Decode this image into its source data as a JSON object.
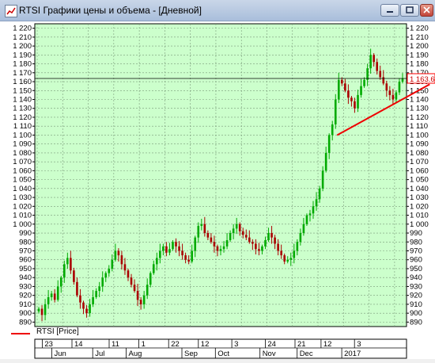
{
  "window": {
    "title": "RTSI Графики цены и объема - [Дневной]",
    "buttons": [
      "minimize",
      "maximize",
      "close"
    ]
  },
  "colors": {
    "plot_bg": "#ccffcc",
    "bull": "#00aa00",
    "bear": "#aa0000",
    "trendline": "#ee0000",
    "price_tag_bg": "#ffffff",
    "price_tag_border": "#ff0000"
  },
  "chart_data": {
    "type": "candlestick",
    "title": "",
    "ylim": [
      885,
      1225
    ],
    "yticks": [
      890,
      900,
      910,
      920,
      930,
      940,
      950,
      960,
      970,
      980,
      990,
      1000,
      1010,
      1020,
      1030,
      1040,
      1050,
      1060,
      1070,
      1080,
      1090,
      1100,
      1110,
      1120,
      1130,
      1140,
      1150,
      1160,
      1170,
      1180,
      1190,
      1200,
      1210,
      1220
    ],
    "ytick_labels": [
      "890",
      "900",
      "910",
      "920",
      "930",
      "940",
      "950",
      "960",
      "970",
      "980",
      "990",
      "1 000",
      "1 010",
      "1 020",
      "1 030",
      "1 040",
      "1 050",
      "1 060",
      "1 070",
      "1 080",
      "1 090",
      "1 100",
      "1 110",
      "1 120",
      "1 130",
      "1 140",
      "1 150",
      "1 160",
      "1 170",
      "1 180",
      "1 190",
      "1 200",
      "1 210",
      "1 220"
    ],
    "last_price_label": "1 163.6",
    "last_price": 1163.6,
    "grid": true,
    "series": [
      {
        "name": "RTSI [Price]"
      }
    ],
    "x_day_labels": [
      "23",
      "14",
      "11",
      "1",
      "22",
      "12",
      "3",
      "24",
      "21",
      "12",
      "3"
    ],
    "x_month_labels": [
      "Jun",
      "Jul",
      "Aug",
      "Sep",
      "Oct",
      "Nov",
      "Dec",
      "2017"
    ],
    "trendline": {
      "from_price": 1100,
      "to_price": 1157
    },
    "closes": [
      905,
      898,
      910,
      918,
      922,
      915,
      930,
      940,
      955,
      962,
      948,
      935,
      920,
      912,
      905,
      900,
      910,
      918,
      925,
      930,
      940,
      945,
      950,
      960,
      970,
      965,
      955,
      948,
      940,
      932,
      925,
      915,
      910,
      920,
      932,
      945,
      955,
      962,
      970,
      975,
      968,
      972,
      980,
      975,
      970,
      965,
      960,
      958,
      970,
      985,
      998,
      1000,
      990,
      985,
      980,
      975,
      970,
      972,
      975,
      982,
      990,
      995,
      1000,
      992,
      988,
      985,
      980,
      978,
      972,
      970,
      975,
      982,
      990,
      985,
      978,
      970,
      965,
      958,
      960,
      962,
      970,
      980,
      990,
      1000,
      1010,
      1012,
      1020,
      1028,
      1040,
      1060,
      1080,
      1100,
      1112,
      1140,
      1162,
      1158,
      1150,
      1142,
      1138,
      1130,
      1145,
      1155,
      1162,
      1175,
      1190,
      1182,
      1172,
      1165,
      1158,
      1150,
      1145,
      1140,
      1148,
      1160,
      1163.6
    ]
  },
  "legend": {
    "label": "RTSI [Price]"
  }
}
